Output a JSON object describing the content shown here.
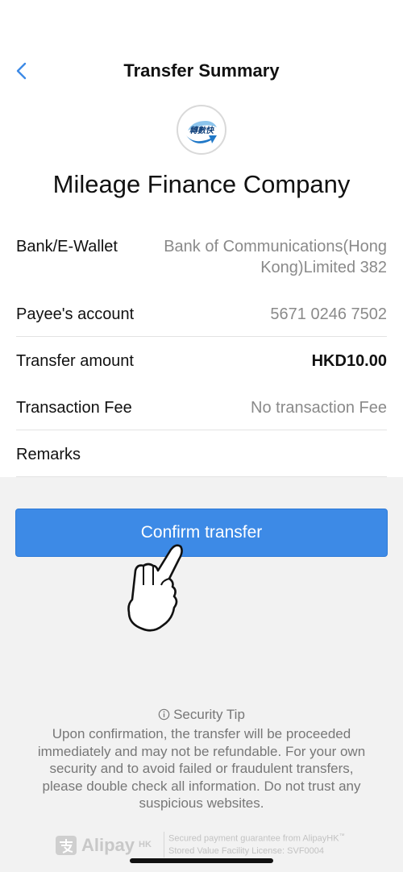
{
  "header": {
    "title": "Transfer Summary"
  },
  "payee": {
    "logo_icon": "fps-logo-icon",
    "name": "Mileage Finance Company"
  },
  "details": [
    {
      "label": "Bank/E-Wallet",
      "value_line1": "Bank of Communications(Hong",
      "value_line2": "Kong)Limited 382"
    },
    {
      "label": "Payee's account",
      "value": "5671 0246 7502"
    },
    {
      "label": "Transfer amount",
      "value": "HKD10.00"
    },
    {
      "label": "Transaction Fee",
      "value": "No transaction Fee"
    },
    {
      "label": "Remarks",
      "value": ""
    }
  ],
  "actions": {
    "confirm_label": "Confirm transfer"
  },
  "security": {
    "title": "Security Tip",
    "body": "Upon confirmation, the transfer will be proceeded immediately and may not be refundable. For your own security and to avoid failed or fraudulent transfers, please double check all information. Do not trust any suspicious websites."
  },
  "footer": {
    "brand": "Alipay",
    "brand_suffix": "HK",
    "line1": "Secured payment guarantee from AlipayHK",
    "line1_mark": "™",
    "line2": "Stored Value Facility License: SVF0004"
  },
  "colors": {
    "accent": "#3d8ae6",
    "background": "#f2f2f2",
    "muted_text": "#8a8a8a"
  }
}
